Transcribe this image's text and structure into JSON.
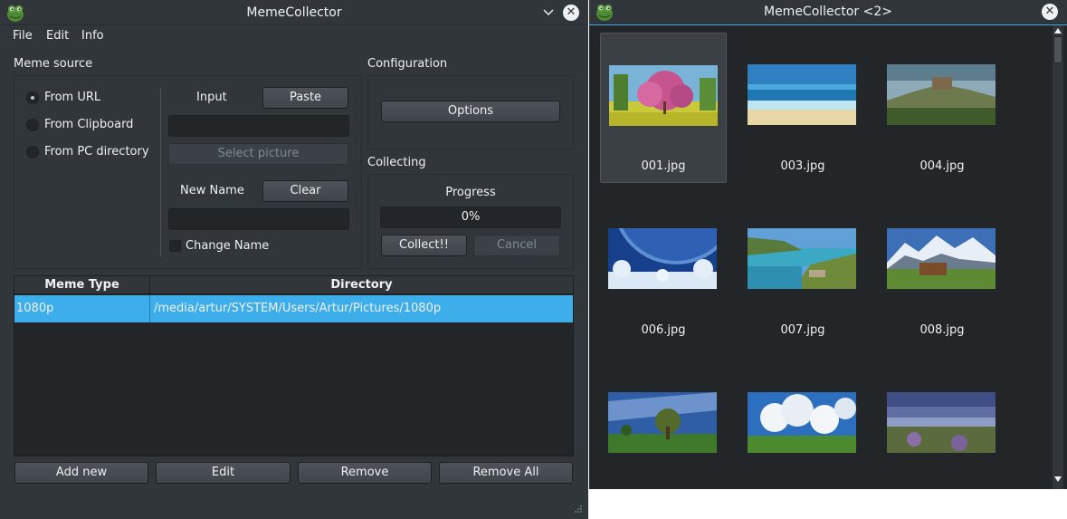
{
  "colors": {
    "accent": "#3daee9",
    "window_bg": "#31363b",
    "field_bg": "#232629"
  },
  "main_window": {
    "title": "MemeCollector",
    "menu": [
      "File",
      "Edit",
      "Info"
    ],
    "meme_source": {
      "heading": "Meme source",
      "options": [
        "From URL",
        "From Clipboard",
        "From PC directory"
      ],
      "selected_index": 0,
      "input_label": "Input",
      "paste_label": "Paste",
      "input_value": "",
      "select_picture_label": "Select picture",
      "new_name_label": "New Name",
      "clear_label": "Clear",
      "new_name_value": "",
      "change_name_label": "Change Name",
      "change_name_checked": false
    },
    "configuration": {
      "heading": "Configuration",
      "options_label": "Options"
    },
    "collecting": {
      "heading": "Collecting",
      "progress_label": "Progress",
      "progress_text": "0%",
      "progress_value": 0,
      "collect_label": "Collect!!",
      "cancel_label": "Cancel"
    },
    "table": {
      "columns": [
        "Meme Type",
        "Directory"
      ],
      "rows": [
        {
          "type": "1080p",
          "directory": "/media/artur/SYSTEM/Users/Artur/Pictures/1080p"
        }
      ]
    },
    "buttons": {
      "add_new": "Add new",
      "edit": "Edit",
      "remove": "Remove",
      "remove_all": "Remove All"
    }
  },
  "gallery_window": {
    "title": "MemeCollector <2>",
    "items": [
      "001.jpg",
      "003.jpg",
      "004.jpg",
      "006.jpg",
      "007.jpg",
      "008.jpg",
      "",
      "",
      ""
    ],
    "selected_index": 0
  }
}
